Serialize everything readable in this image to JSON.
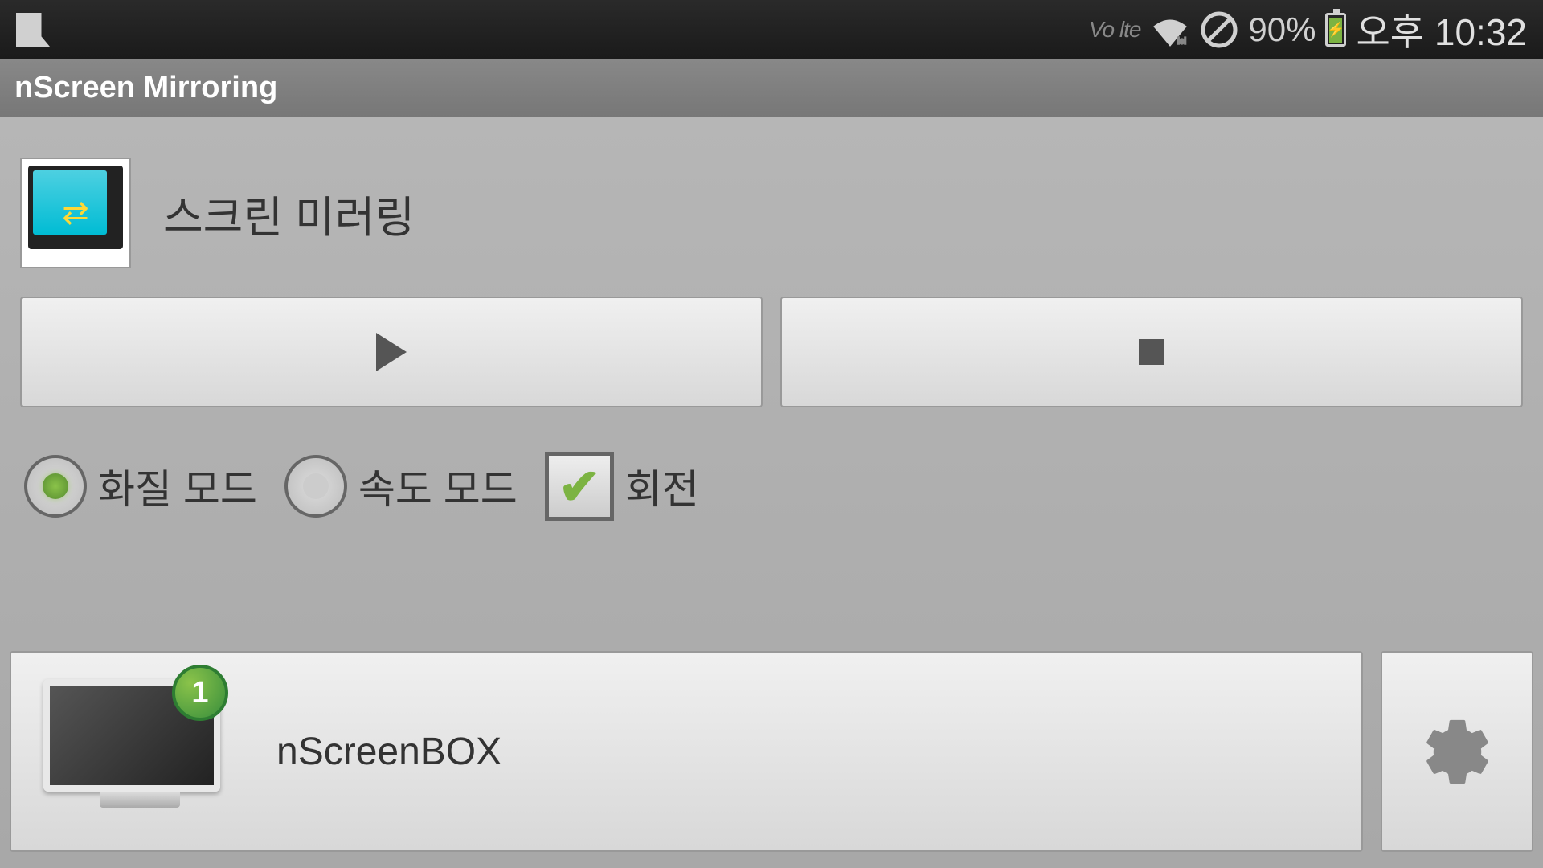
{
  "status_bar": {
    "volte": "Vo lte",
    "battery_percent": "90%",
    "time": "오후 10:32"
  },
  "app_title": "nScreen Mirroring",
  "section_title": "스크린 미러링",
  "options": {
    "quality_mode": "화질 모드",
    "speed_mode": "속도 모드",
    "rotation": "회전",
    "quality_selected": true,
    "speed_selected": false,
    "rotation_checked": true
  },
  "device": {
    "name": "nScreenBOX",
    "badge": "1"
  }
}
